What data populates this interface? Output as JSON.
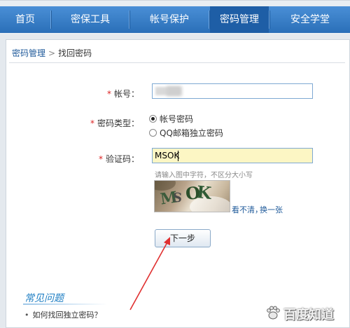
{
  "nav": {
    "items": [
      {
        "label": "首页"
      },
      {
        "label": "密保工具"
      },
      {
        "label": "帐号保护"
      },
      {
        "label": "密码管理"
      },
      {
        "label": "安全学堂"
      }
    ],
    "active": "密码管理"
  },
  "breadcrumb": {
    "parent": "密码管理",
    "separator": ">",
    "current": "找回密码"
  },
  "form": {
    "account_label": "帐号：",
    "password_type_label": "密码类型：",
    "password_type_options": [
      "帐号密码",
      "QQ邮箱独立密码"
    ],
    "password_type_selected": "帐号密码",
    "captcha_label": "验证码：",
    "captcha_value": "MSOK",
    "captcha_hint": "请输入图中字符，不区分大小写",
    "captcha_glyphs": [
      "M",
      "S",
      "O",
      "K"
    ],
    "refresh_link_1": "看不清，",
    "refresh_link_2": "换一张",
    "next_button": "下一步"
  },
  "faq": {
    "title": "常见问题",
    "items": [
      "如何找回独立密码？"
    ]
  },
  "watermark": {
    "text": "百度知道"
  },
  "colors": {
    "nav_bar": "#2a6fb8",
    "nav_active": "#1e5ea6",
    "link": "#1f5a9a",
    "required_star": "#dd2222",
    "captcha_input_bg": "#fcf6c4",
    "annotation_arrow": "#e03030"
  }
}
